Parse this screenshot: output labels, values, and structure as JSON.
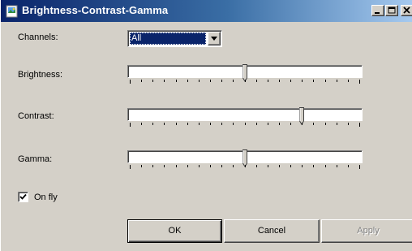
{
  "window": {
    "title": "Brightness-Contrast-Gamma",
    "icon": "image-icon"
  },
  "channels": {
    "label": "Channels:",
    "selected": "All"
  },
  "brightness": {
    "label": "Brightness:",
    "value_fraction": 0.5
  },
  "contrast": {
    "label": "Contrast:",
    "value_fraction": 0.75
  },
  "gamma": {
    "label": "Gamma:",
    "value_fraction": 0.5
  },
  "on_fly": {
    "label": "On fly",
    "checked": true
  },
  "buttons": {
    "ok": "OK",
    "cancel": "Cancel",
    "apply": "Apply"
  }
}
